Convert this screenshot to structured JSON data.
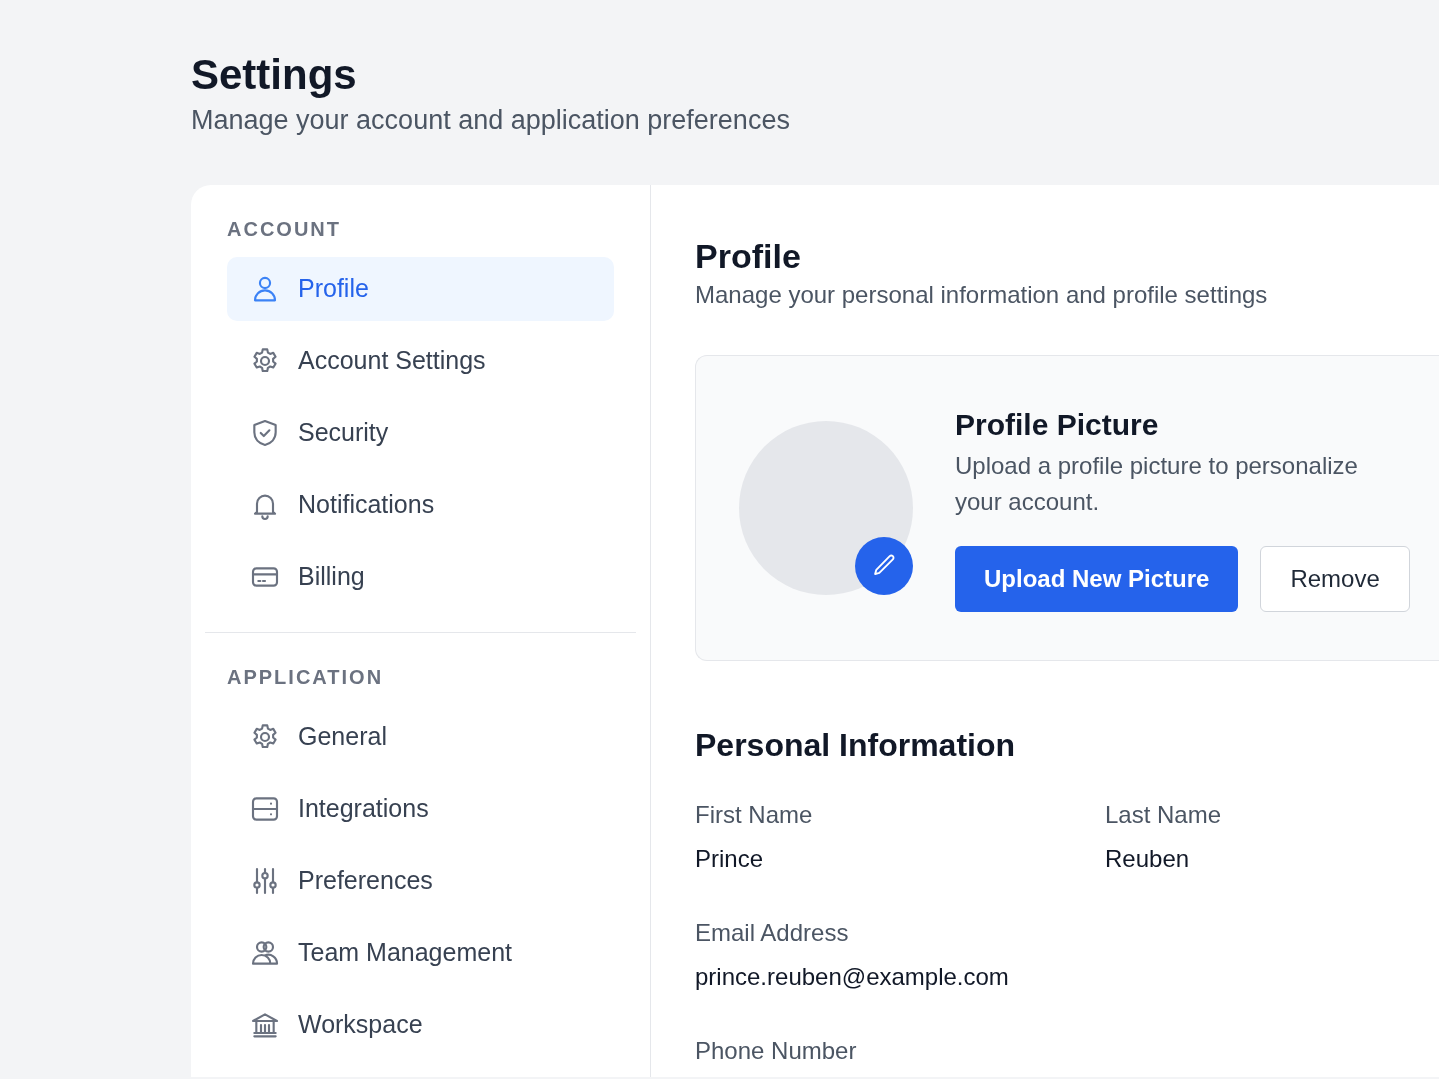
{
  "header": {
    "title": "Settings",
    "subtitle": "Manage your account and application preferences"
  },
  "sidebar": {
    "sections": [
      {
        "label": "ACCOUNT",
        "items": [
          {
            "label": "Profile",
            "selected": true
          },
          {
            "label": "Account Settings",
            "selected": false
          },
          {
            "label": "Security",
            "selected": false
          },
          {
            "label": "Notifications",
            "selected": false
          },
          {
            "label": "Billing",
            "selected": false
          }
        ]
      },
      {
        "label": "APPLICATION",
        "items": [
          {
            "label": "General",
            "selected": false
          },
          {
            "label": "Integrations",
            "selected": false
          },
          {
            "label": "Preferences",
            "selected": false
          },
          {
            "label": "Team Management",
            "selected": false
          },
          {
            "label": "Workspace",
            "selected": false
          }
        ]
      }
    ]
  },
  "main": {
    "title": "Profile",
    "subtitle": "Manage your personal information and profile settings",
    "picture": {
      "title": "Profile Picture",
      "description": "Upload a profile picture to personalize your account.",
      "upload_button": "Upload New Picture",
      "remove_button": "Remove"
    },
    "personal_information": {
      "title": "Personal Information",
      "fields": [
        {
          "label": "First Name",
          "value": "Prince"
        },
        {
          "label": "Last Name",
          "value": "Reuben"
        },
        {
          "label": "Email Address",
          "value": "prince.reuben@example.com"
        },
        {
          "label": "Phone Number"
        }
      ]
    }
  }
}
